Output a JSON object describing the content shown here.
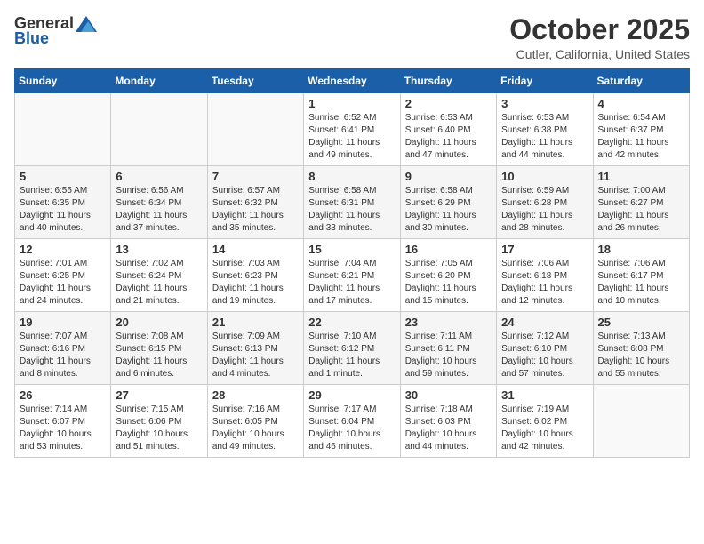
{
  "header": {
    "logo_general": "General",
    "logo_blue": "Blue",
    "month": "October 2025",
    "location": "Cutler, California, United States"
  },
  "weekdays": [
    "Sunday",
    "Monday",
    "Tuesday",
    "Wednesday",
    "Thursday",
    "Friday",
    "Saturday"
  ],
  "weeks": [
    [
      {
        "day": "",
        "info": ""
      },
      {
        "day": "",
        "info": ""
      },
      {
        "day": "",
        "info": ""
      },
      {
        "day": "1",
        "info": "Sunrise: 6:52 AM\nSunset: 6:41 PM\nDaylight: 11 hours and 49 minutes."
      },
      {
        "day": "2",
        "info": "Sunrise: 6:53 AM\nSunset: 6:40 PM\nDaylight: 11 hours and 47 minutes."
      },
      {
        "day": "3",
        "info": "Sunrise: 6:53 AM\nSunset: 6:38 PM\nDaylight: 11 hours and 44 minutes."
      },
      {
        "day": "4",
        "info": "Sunrise: 6:54 AM\nSunset: 6:37 PM\nDaylight: 11 hours and 42 minutes."
      }
    ],
    [
      {
        "day": "5",
        "info": "Sunrise: 6:55 AM\nSunset: 6:35 PM\nDaylight: 11 hours and 40 minutes."
      },
      {
        "day": "6",
        "info": "Sunrise: 6:56 AM\nSunset: 6:34 PM\nDaylight: 11 hours and 37 minutes."
      },
      {
        "day": "7",
        "info": "Sunrise: 6:57 AM\nSunset: 6:32 PM\nDaylight: 11 hours and 35 minutes."
      },
      {
        "day": "8",
        "info": "Sunrise: 6:58 AM\nSunset: 6:31 PM\nDaylight: 11 hours and 33 minutes."
      },
      {
        "day": "9",
        "info": "Sunrise: 6:58 AM\nSunset: 6:29 PM\nDaylight: 11 hours and 30 minutes."
      },
      {
        "day": "10",
        "info": "Sunrise: 6:59 AM\nSunset: 6:28 PM\nDaylight: 11 hours and 28 minutes."
      },
      {
        "day": "11",
        "info": "Sunrise: 7:00 AM\nSunset: 6:27 PM\nDaylight: 11 hours and 26 minutes."
      }
    ],
    [
      {
        "day": "12",
        "info": "Sunrise: 7:01 AM\nSunset: 6:25 PM\nDaylight: 11 hours and 24 minutes."
      },
      {
        "day": "13",
        "info": "Sunrise: 7:02 AM\nSunset: 6:24 PM\nDaylight: 11 hours and 21 minutes."
      },
      {
        "day": "14",
        "info": "Sunrise: 7:03 AM\nSunset: 6:23 PM\nDaylight: 11 hours and 19 minutes."
      },
      {
        "day": "15",
        "info": "Sunrise: 7:04 AM\nSunset: 6:21 PM\nDaylight: 11 hours and 17 minutes."
      },
      {
        "day": "16",
        "info": "Sunrise: 7:05 AM\nSunset: 6:20 PM\nDaylight: 11 hours and 15 minutes."
      },
      {
        "day": "17",
        "info": "Sunrise: 7:06 AM\nSunset: 6:18 PM\nDaylight: 11 hours and 12 minutes."
      },
      {
        "day": "18",
        "info": "Sunrise: 7:06 AM\nSunset: 6:17 PM\nDaylight: 11 hours and 10 minutes."
      }
    ],
    [
      {
        "day": "19",
        "info": "Sunrise: 7:07 AM\nSunset: 6:16 PM\nDaylight: 11 hours and 8 minutes."
      },
      {
        "day": "20",
        "info": "Sunrise: 7:08 AM\nSunset: 6:15 PM\nDaylight: 11 hours and 6 minutes."
      },
      {
        "day": "21",
        "info": "Sunrise: 7:09 AM\nSunset: 6:13 PM\nDaylight: 11 hours and 4 minutes."
      },
      {
        "day": "22",
        "info": "Sunrise: 7:10 AM\nSunset: 6:12 PM\nDaylight: 11 hours and 1 minute."
      },
      {
        "day": "23",
        "info": "Sunrise: 7:11 AM\nSunset: 6:11 PM\nDaylight: 10 hours and 59 minutes."
      },
      {
        "day": "24",
        "info": "Sunrise: 7:12 AM\nSunset: 6:10 PM\nDaylight: 10 hours and 57 minutes."
      },
      {
        "day": "25",
        "info": "Sunrise: 7:13 AM\nSunset: 6:08 PM\nDaylight: 10 hours and 55 minutes."
      }
    ],
    [
      {
        "day": "26",
        "info": "Sunrise: 7:14 AM\nSunset: 6:07 PM\nDaylight: 10 hours and 53 minutes."
      },
      {
        "day": "27",
        "info": "Sunrise: 7:15 AM\nSunset: 6:06 PM\nDaylight: 10 hours and 51 minutes."
      },
      {
        "day": "28",
        "info": "Sunrise: 7:16 AM\nSunset: 6:05 PM\nDaylight: 10 hours and 49 minutes."
      },
      {
        "day": "29",
        "info": "Sunrise: 7:17 AM\nSunset: 6:04 PM\nDaylight: 10 hours and 46 minutes."
      },
      {
        "day": "30",
        "info": "Sunrise: 7:18 AM\nSunset: 6:03 PM\nDaylight: 10 hours and 44 minutes."
      },
      {
        "day": "31",
        "info": "Sunrise: 7:19 AM\nSunset: 6:02 PM\nDaylight: 10 hours and 42 minutes."
      },
      {
        "day": "",
        "info": ""
      }
    ]
  ]
}
